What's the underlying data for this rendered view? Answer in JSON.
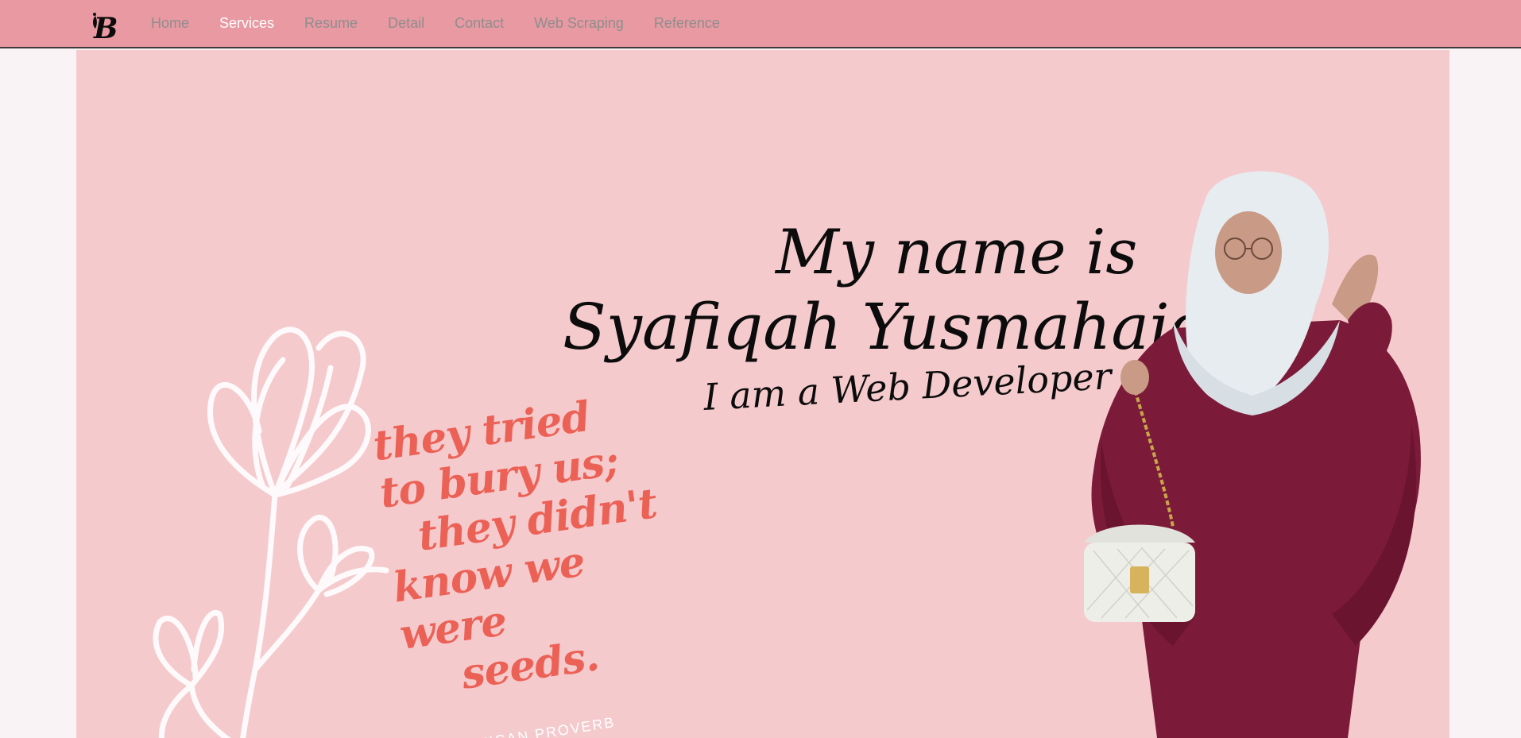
{
  "nav": {
    "items": [
      {
        "label": "Home",
        "active": false
      },
      {
        "label": "Services",
        "active": true
      },
      {
        "label": "Resume",
        "active": false
      },
      {
        "label": "Detail",
        "active": false
      },
      {
        "label": "Contact",
        "active": false
      },
      {
        "label": "Web Scraping",
        "active": false
      },
      {
        "label": "Reference",
        "active": false
      }
    ],
    "brand_letter": "B"
  },
  "hero": {
    "greeting": "My name is",
    "name": "Syafiqah Yusmahaidi.",
    "role": "I am a Web Developer",
    "quote_lines": [
      "they tried",
      "to bury us;",
      "they didn't",
      "know we were",
      "seeds."
    ],
    "attribution": "MEXICAN PROVERB"
  },
  "colors": {
    "navbar": "#e899a2",
    "hero_background": "#f5cacd",
    "quote": "#ec6156",
    "page_background": "#faf3f6"
  }
}
